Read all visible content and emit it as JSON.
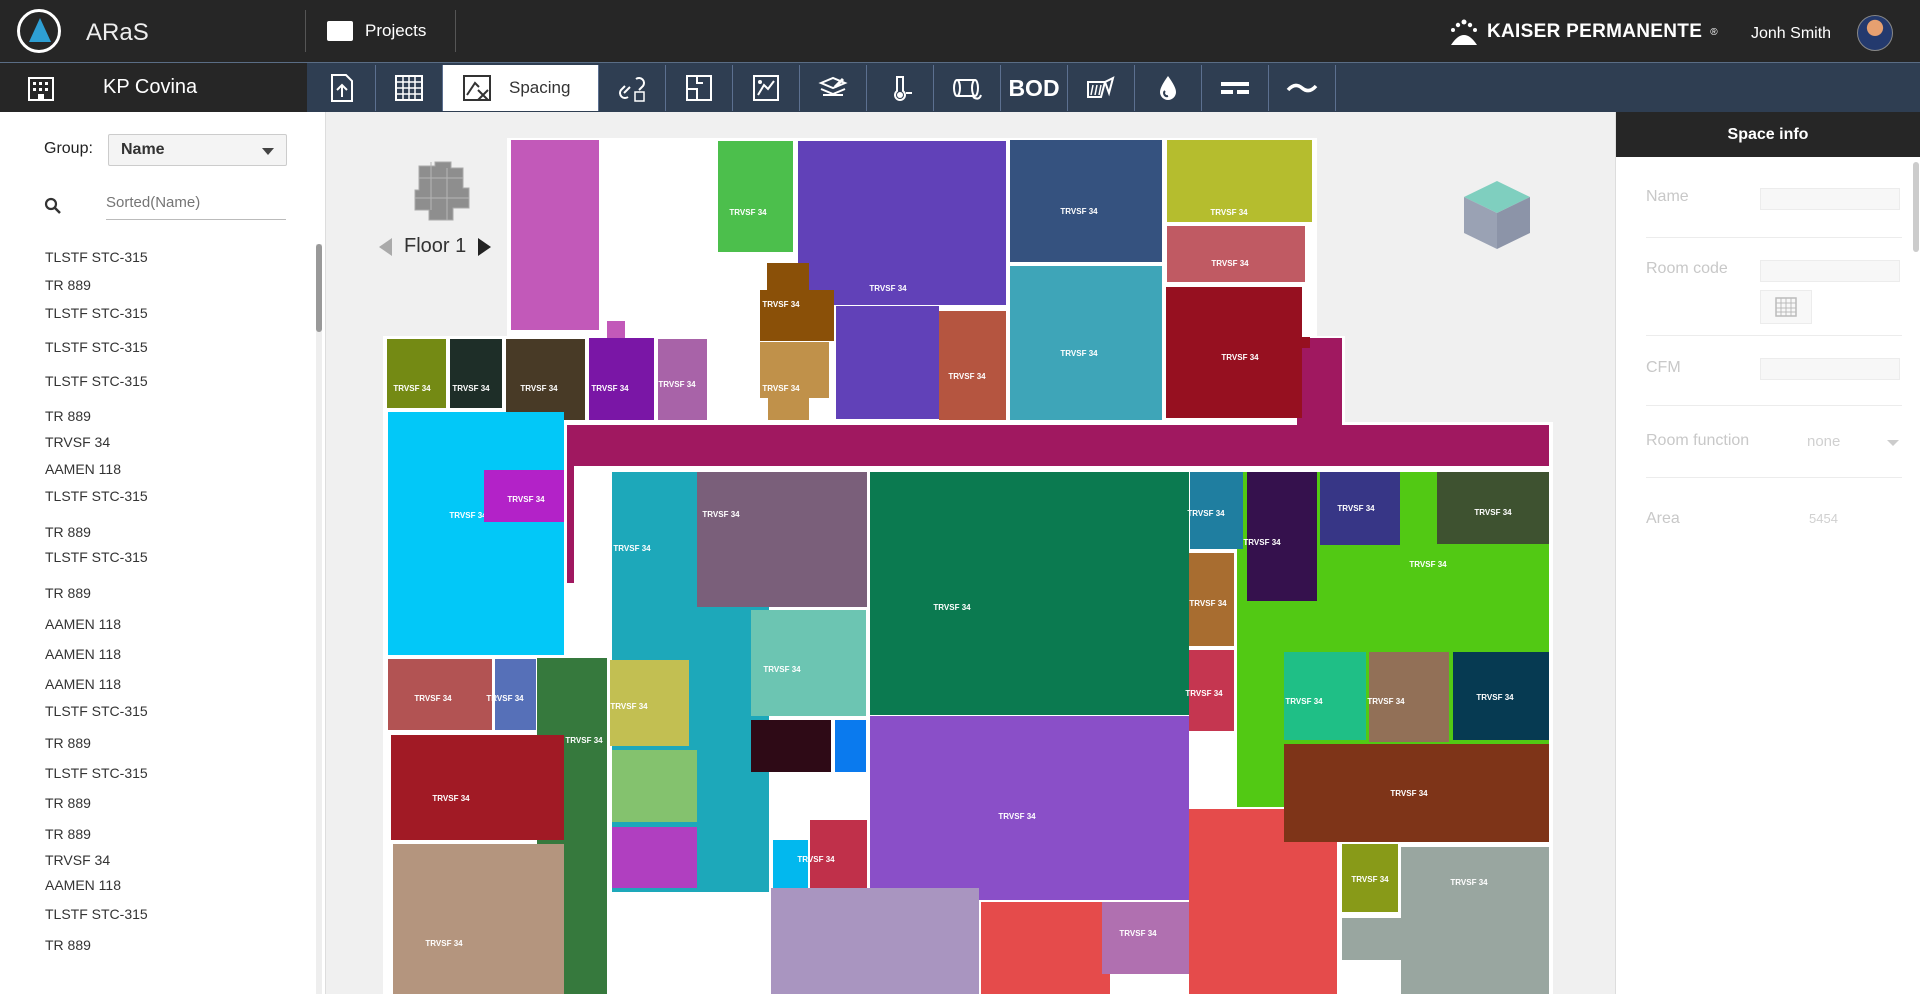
{
  "app": {
    "name": "ARaS"
  },
  "nav": {
    "projects_label": "Projects"
  },
  "brand": {
    "name": "KAISER PERMANENTE",
    "mark": "®"
  },
  "user": {
    "name": "Jonh Smith"
  },
  "project": {
    "title": "KP Covina"
  },
  "toolbar": {
    "active_label": "Spacing",
    "bod_label": "BOD",
    "icons": [
      "import-file-icon",
      "grid-table-icon",
      "spacing-icon",
      "link-icon",
      "floorplan-icon",
      "zone-icon",
      "edit-layer-icon",
      "thermal-icon",
      "duct-icon",
      "bod-icon",
      "equipment-icon",
      "water-drop-icon",
      "lines-icon",
      "wave-icon"
    ]
  },
  "left_panel": {
    "group_label": "Group:",
    "group_value": "Name",
    "search_placeholder": "Sorted(Name)",
    "items": [
      "TLSTF STC-315",
      "TR 889",
      "TLSTF STC-315",
      "TLSTF STC-315",
      "TLSTF STC-315",
      "TR 889",
      "TRVSF 34",
      "AAMEN 118",
      "TLSTF STC-315",
      "TR 889",
      "TLSTF STC-315",
      "TR 889",
      "AAMEN 118",
      "AAMEN 118",
      "AAMEN 118",
      "TLSTF STC-315",
      "TR 889",
      "TLSTF STC-315",
      "TR 889",
      "TR 889",
      "TRVSF 34",
      "AAMEN 118",
      "TLSTF STC-315",
      "TR 889"
    ]
  },
  "canvas": {
    "floor_label": "Floor 1",
    "room_label": "TRVSF 34",
    "rooms": [
      {
        "color": "#c259b9",
        "label": true
      },
      {
        "color": "#4cbf4c",
        "label": true
      },
      {
        "color": "#6141b8",
        "label": true
      },
      {
        "color": "#35527f",
        "label": true
      },
      {
        "color": "#b5bd2e",
        "label": true
      },
      {
        "color": "#c05a63",
        "label": true
      },
      {
        "color": "#8a5008",
        "label": true
      },
      {
        "color": "#c0914a",
        "label": true
      },
      {
        "color": "#b55540",
        "label": true
      },
      {
        "color": "#3ea5b8",
        "label": true
      },
      {
        "color": "#961020",
        "label": true
      },
      {
        "color": "#748a14",
        "label": true
      },
      {
        "color": "#1e2e28",
        "label": true
      },
      {
        "color": "#483a26",
        "label": true
      },
      {
        "color": "#7a16a6",
        "label": true
      },
      {
        "color": "#a863a8",
        "label": true
      },
      {
        "color": "#a01860",
        "label": false
      },
      {
        "color": "#02c8f8",
        "label": true
      },
      {
        "color": "#b322c8",
        "label": true
      },
      {
        "color": "#1da8ba",
        "label": true
      },
      {
        "color": "#7a5f7a",
        "label": true
      },
      {
        "color": "#0b7a50",
        "label": true
      },
      {
        "color": "#1f7ea0",
        "label": true
      },
      {
        "color": "#35114d",
        "label": true
      },
      {
        "color": "#373686",
        "label": true
      },
      {
        "color": "#52c914",
        "label": true
      },
      {
        "color": "#3e5230",
        "label": true
      },
      {
        "color": "#a86d30",
        "label": true
      },
      {
        "color": "#c53650",
        "label": true
      },
      {
        "color": "#1fbf86",
        "label": true
      },
      {
        "color": "#927057",
        "label": true
      },
      {
        "color": "#063a52",
        "label": true
      },
      {
        "color": "#7e3418",
        "label": true
      },
      {
        "color": "#b25353",
        "label": true
      },
      {
        "color": "#5670b8",
        "label": true
      },
      {
        "color": "#36793d",
        "label": true
      },
      {
        "color": "#c2bf52",
        "label": true
      },
      {
        "color": "#6cc5b2",
        "label": true
      },
      {
        "color": "#2e0a16",
        "label": false
      },
      {
        "color": "#0a7aee",
        "label": false
      },
      {
        "color": "#84c26e",
        "label": false
      },
      {
        "color": "#b03fc0",
        "label": false
      },
      {
        "color": "#02b8ee",
        "label": false
      },
      {
        "color": "#c0304a",
        "label": true
      },
      {
        "color": "#8a4fc8",
        "label": true
      },
      {
        "color": "#a11a25",
        "label": true
      },
      {
        "color": "#b4957e",
        "label": true
      },
      {
        "color": "#a995c0",
        "label": false
      },
      {
        "color": "#e54b4b",
        "label": false
      },
      {
        "color": "#b070b0",
        "label": true
      },
      {
        "color": "#889a18",
        "label": true
      },
      {
        "color": "#99a6a0",
        "label": true
      }
    ]
  },
  "space_info": {
    "title": "Space info",
    "name_label": "Name",
    "room_code_label": "Room code",
    "cfm_label": "CFM",
    "room_function_label": "Room function",
    "room_function_value": "none",
    "area_label": "Area",
    "area_value": "5454"
  }
}
